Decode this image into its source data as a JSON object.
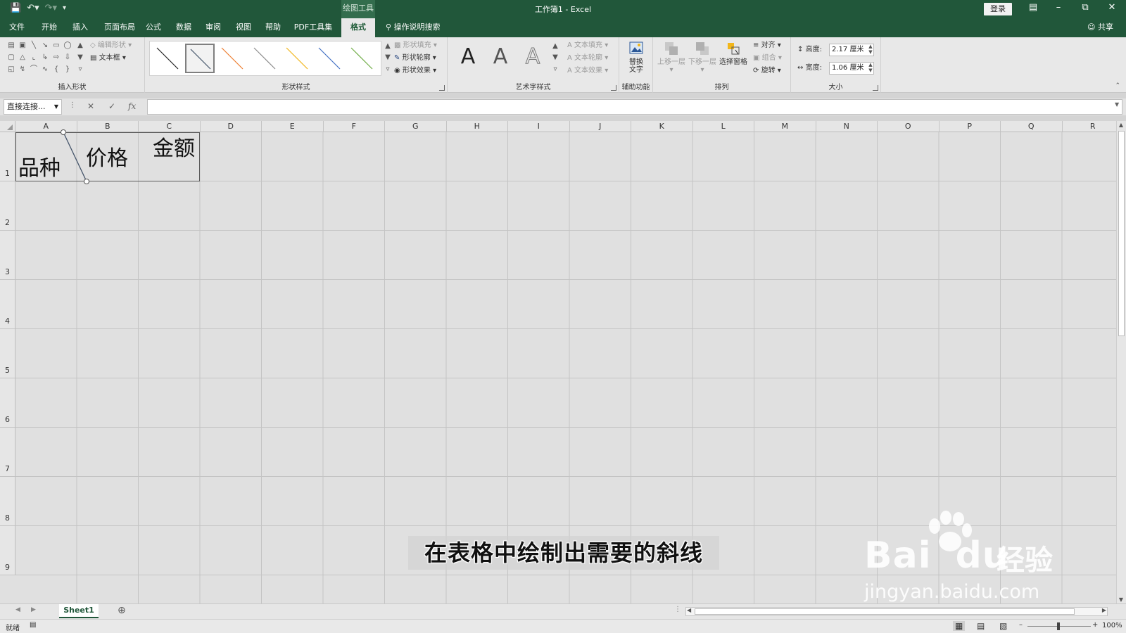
{
  "qat": {
    "save_icon": "save-icon",
    "undo_icon": "undo-icon",
    "redo_icon": "redo-icon",
    "customize_icon": "customize-qat-icon"
  },
  "title": {
    "context_group": "绘图工具",
    "document": "工作簿1  -  Excel",
    "login": "登录"
  },
  "tabs": [
    {
      "label": "文件"
    },
    {
      "label": "开始"
    },
    {
      "label": "插入"
    },
    {
      "label": "页面布局"
    },
    {
      "label": "公式"
    },
    {
      "label": "数据"
    },
    {
      "label": "审阅"
    },
    {
      "label": "视图"
    },
    {
      "label": "帮助"
    },
    {
      "label": "PDF工具集"
    },
    {
      "label": "格式"
    }
  ],
  "tell_me": "操作说明搜索",
  "share": "共享",
  "ribbon": {
    "insert_shapes": {
      "label": "插入形状",
      "edit_shape": "编辑形状",
      "text_box": "文本框"
    },
    "shape_styles": {
      "label": "形状样式",
      "fill": "形状填充",
      "outline": "形状轮廓",
      "effects": "形状效果"
    },
    "wordart": {
      "label": "艺术字样式",
      "sample": "A",
      "text_fill": "文本填充",
      "text_outline": "文本轮廓",
      "text_effects": "文本效果"
    },
    "accessibility": {
      "label": "辅助功能",
      "alt_text_line1": "替换",
      "alt_text_line2": "文字"
    },
    "arrange": {
      "label": "排列",
      "bring_forward": "上移一层",
      "send_backward": "下移一层",
      "selection_pane": "选择窗格",
      "align": "对齐",
      "group": "组合",
      "rotate": "旋转"
    },
    "size": {
      "label": "大小",
      "height_label": "高度:",
      "height_value": "2.17 厘米",
      "width_label": "宽度:",
      "width_value": "1.06 厘米"
    }
  },
  "formula_bar": {
    "name_box": "直接连接...",
    "fx": "fx",
    "content": ""
  },
  "columns": [
    "A",
    "B",
    "C",
    "D",
    "E",
    "F",
    "G",
    "H",
    "I",
    "J",
    "K",
    "L",
    "M",
    "N",
    "O",
    "P",
    "Q",
    "R"
  ],
  "rows": [
    "1",
    "2",
    "3",
    "4",
    "5",
    "6",
    "7",
    "8",
    "9"
  ],
  "cells": {
    "a1": "品种",
    "b1": "价格",
    "c1": "金额"
  },
  "sheet_tab": "Sheet1",
  "status": {
    "ready": "就绪",
    "zoom": "100%"
  },
  "subtitle": "在表格中绘制出需要的斜线",
  "watermark": {
    "brand": "Bai",
    "brand2": "du",
    "cn": "经验",
    "url": "jingyan.baidu.com"
  },
  "colors": {
    "brand_green": "#21573a",
    "line_blue": "#44546a"
  }
}
